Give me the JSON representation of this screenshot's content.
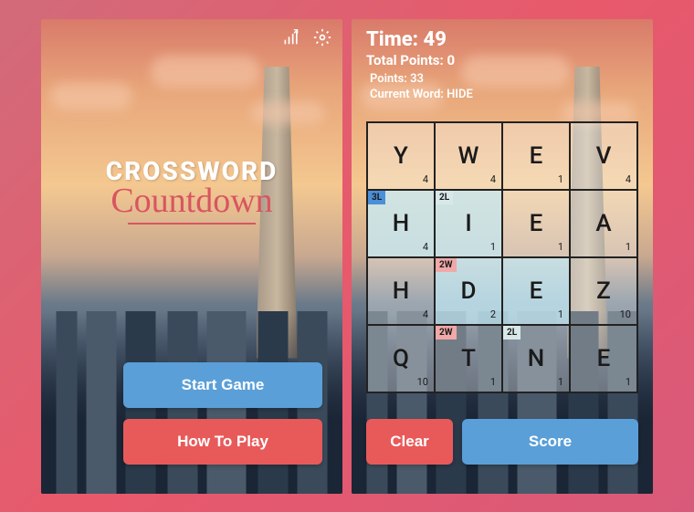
{
  "title": {
    "top": "CROSSWORD",
    "bottom": "Countdown"
  },
  "menu": {
    "start": "Start Game",
    "howto": "How To Play"
  },
  "game": {
    "time_label": "Time:",
    "time_value": "49",
    "total_label": "Total Points:",
    "total_value": "0",
    "points_label": "Points:",
    "points_value": "33",
    "current_label": "Current Word:",
    "current_value": "HIDE",
    "clear": "Clear",
    "score": "Score"
  },
  "grid": [
    [
      {
        "l": "Y",
        "p": "4"
      },
      {
        "l": "W",
        "p": "4"
      },
      {
        "l": "E",
        "p": "1"
      },
      {
        "l": "V",
        "p": "4"
      }
    ],
    [
      {
        "l": "H",
        "p": "4",
        "bonus": "3L",
        "sel": true
      },
      {
        "l": "I",
        "p": "1",
        "bonus": "2L",
        "sel": true
      },
      {
        "l": "E",
        "p": "1"
      },
      {
        "l": "A",
        "p": "1"
      }
    ],
    [
      {
        "l": "H",
        "p": "4"
      },
      {
        "l": "D",
        "p": "2",
        "bonus": "2W",
        "sel": true
      },
      {
        "l": "E",
        "p": "1",
        "sel": true
      },
      {
        "l": "Z",
        "p": "10"
      }
    ],
    [
      {
        "l": "Q",
        "p": "10"
      },
      {
        "l": "T",
        "p": "1",
        "bonus": "2W"
      },
      {
        "l": "N",
        "p": "1",
        "bonus": "2L"
      },
      {
        "l": "E",
        "p": "1"
      }
    ]
  ]
}
